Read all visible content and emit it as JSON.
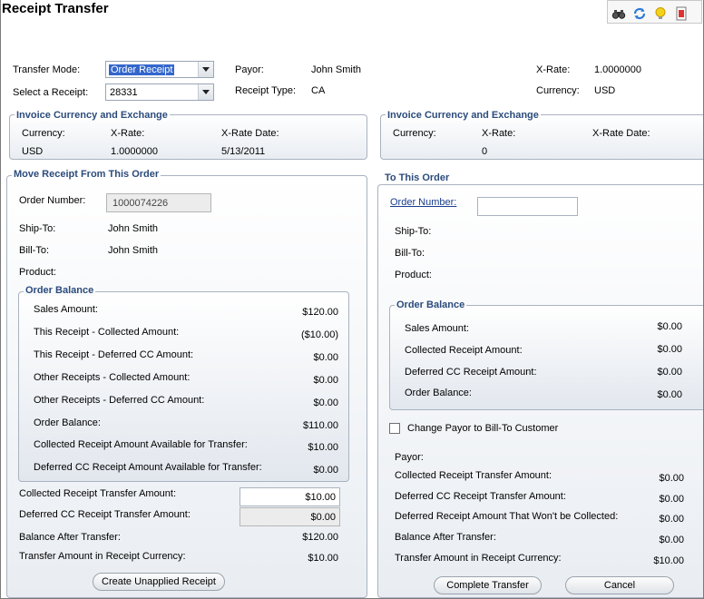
{
  "title": "Receipt Transfer",
  "toolbar": {
    "icons": [
      "binoculars-icon",
      "refresh-icon",
      "lightbulb-icon",
      "help-icon"
    ]
  },
  "header": {
    "transfer_mode_label": "Transfer Mode:",
    "transfer_mode_value": "Order Receipt",
    "select_receipt_label": "Select a Receipt:",
    "select_receipt_value": "28331",
    "payor_label": "Payor:",
    "payor_value": "John Smith",
    "receipt_type_label": "Receipt Type:",
    "receipt_type_value": "CA",
    "xrate_label": "X-Rate:",
    "xrate_value": "1.0000000",
    "currency_label": "Currency:",
    "currency_value": "USD"
  },
  "left_currency": {
    "title": "Invoice Currency and Exchange",
    "currency_label": "Currency:",
    "currency_value": "USD",
    "xrate_label": "X-Rate:",
    "xrate_value": "1.0000000",
    "xrate_date_label": "X-Rate Date:",
    "xrate_date_value": "5/13/2011"
  },
  "right_currency": {
    "title": "Invoice Currency and Exchange",
    "currency_label": "Currency:",
    "xrate_label": "X-Rate:",
    "xrate_value": "0",
    "xrate_date_label": "X-Rate Date:"
  },
  "from_order": {
    "title": "Move Receipt From This Order",
    "order_number_label": "Order Number:",
    "order_number_value": "1000074226",
    "ship_to_label": "Ship-To:",
    "ship_to_value": "John Smith",
    "bill_to_label": "Bill-To:",
    "bill_to_value": "John Smith",
    "product_label": "Product:",
    "balance_title": "Order Balance",
    "balance_rows": [
      {
        "label": "Sales Amount:",
        "value": "$120.00"
      },
      {
        "label": "This Receipt - Collected Amount:",
        "value": "($10.00)"
      },
      {
        "label": "This Receipt - Deferred CC Amount:",
        "value": "$0.00"
      },
      {
        "label": "Other Receipts - Collected Amount:",
        "value": "$0.00"
      },
      {
        "label": "Other Receipts - Deferred CC Amount:",
        "value": "$0.00"
      },
      {
        "label": "Order Balance:",
        "value": "$110.00"
      },
      {
        "label": "Collected Receipt Amount Available for Transfer:",
        "value": "$10.00"
      },
      {
        "label": "Deferred CC Receipt Amount Available for  Transfer:",
        "value": "$0.00"
      }
    ],
    "collected_transfer_label": "Collected Receipt Transfer Amount:",
    "collected_transfer_value": "$10.00",
    "deferred_transfer_label": "Deferred CC Receipt Transfer Amount:",
    "deferred_transfer_value": "$0.00",
    "balance_after_label": "Balance After Transfer:",
    "balance_after_value": "$120.00",
    "transfer_currency_label": "Transfer Amount in Receipt Currency:",
    "transfer_currency_value": "$10.00",
    "create_button": "Create Unapplied Receipt"
  },
  "to_order": {
    "title": "To This Order",
    "order_number_label": "Order Number:",
    "order_number_value": "",
    "ship_to_label": "Ship-To:",
    "bill_to_label": "Bill-To:",
    "product_label": "Product:",
    "balance_title": "Order Balance",
    "balance_rows": [
      {
        "label": "Sales Amount:",
        "value": "$0.00"
      },
      {
        "label": "Collected Receipt Amount:",
        "value": "$0.00"
      },
      {
        "label": "Deferred CC Receipt Amount:",
        "value": "$0.00"
      },
      {
        "label": "Order Balance:",
        "value": "$0.00"
      }
    ],
    "change_payor_label": "Change Payor to Bill-To Customer",
    "change_payor_checked": false,
    "payor_label": "Payor:",
    "summary_rows": [
      {
        "label": "Collected Receipt Transfer Amount:",
        "value": "$0.00"
      },
      {
        "label": "Deferred CC Receipt Transfer Amount:",
        "value": "$0.00"
      },
      {
        "label": "Deferred Receipt Amount That Won't be Collected:",
        "value": "$0.00"
      },
      {
        "label": "Balance After Transfer:",
        "value": "$0.00"
      },
      {
        "label": "Transfer Amount in Receipt Currency:",
        "value": "$10.00"
      }
    ],
    "complete_button": "Complete Transfer",
    "cancel_button": "Cancel"
  }
}
